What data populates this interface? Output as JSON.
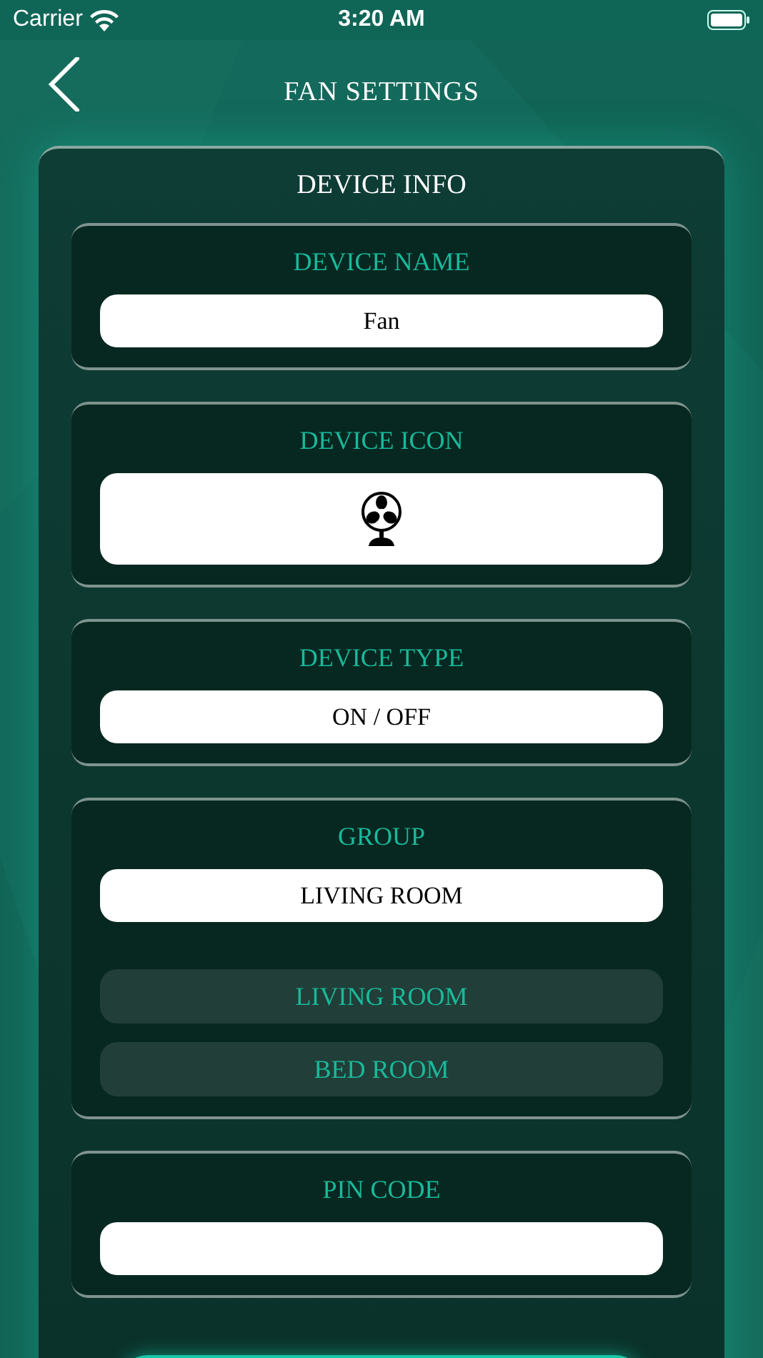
{
  "status_bar": {
    "carrier": "Carrier",
    "time": "3:20 AM"
  },
  "nav": {
    "title": "FAN SETTINGS"
  },
  "panel": {
    "title": "DEVICE INFO"
  },
  "sections": [
    {
      "kind": "text",
      "label": "DEVICE NAME",
      "value": "Fan"
    },
    {
      "kind": "icon",
      "label": "DEVICE ICON"
    },
    {
      "kind": "text",
      "label": "DEVICE TYPE",
      "value": "ON / OFF"
    },
    {
      "kind": "dropdown",
      "label": "GROUP",
      "value": "LIVING ROOM",
      "options": [
        "LIVING ROOM",
        "BED ROOM"
      ]
    },
    {
      "kind": "text",
      "label": "PIN CODE"
    }
  ]
}
